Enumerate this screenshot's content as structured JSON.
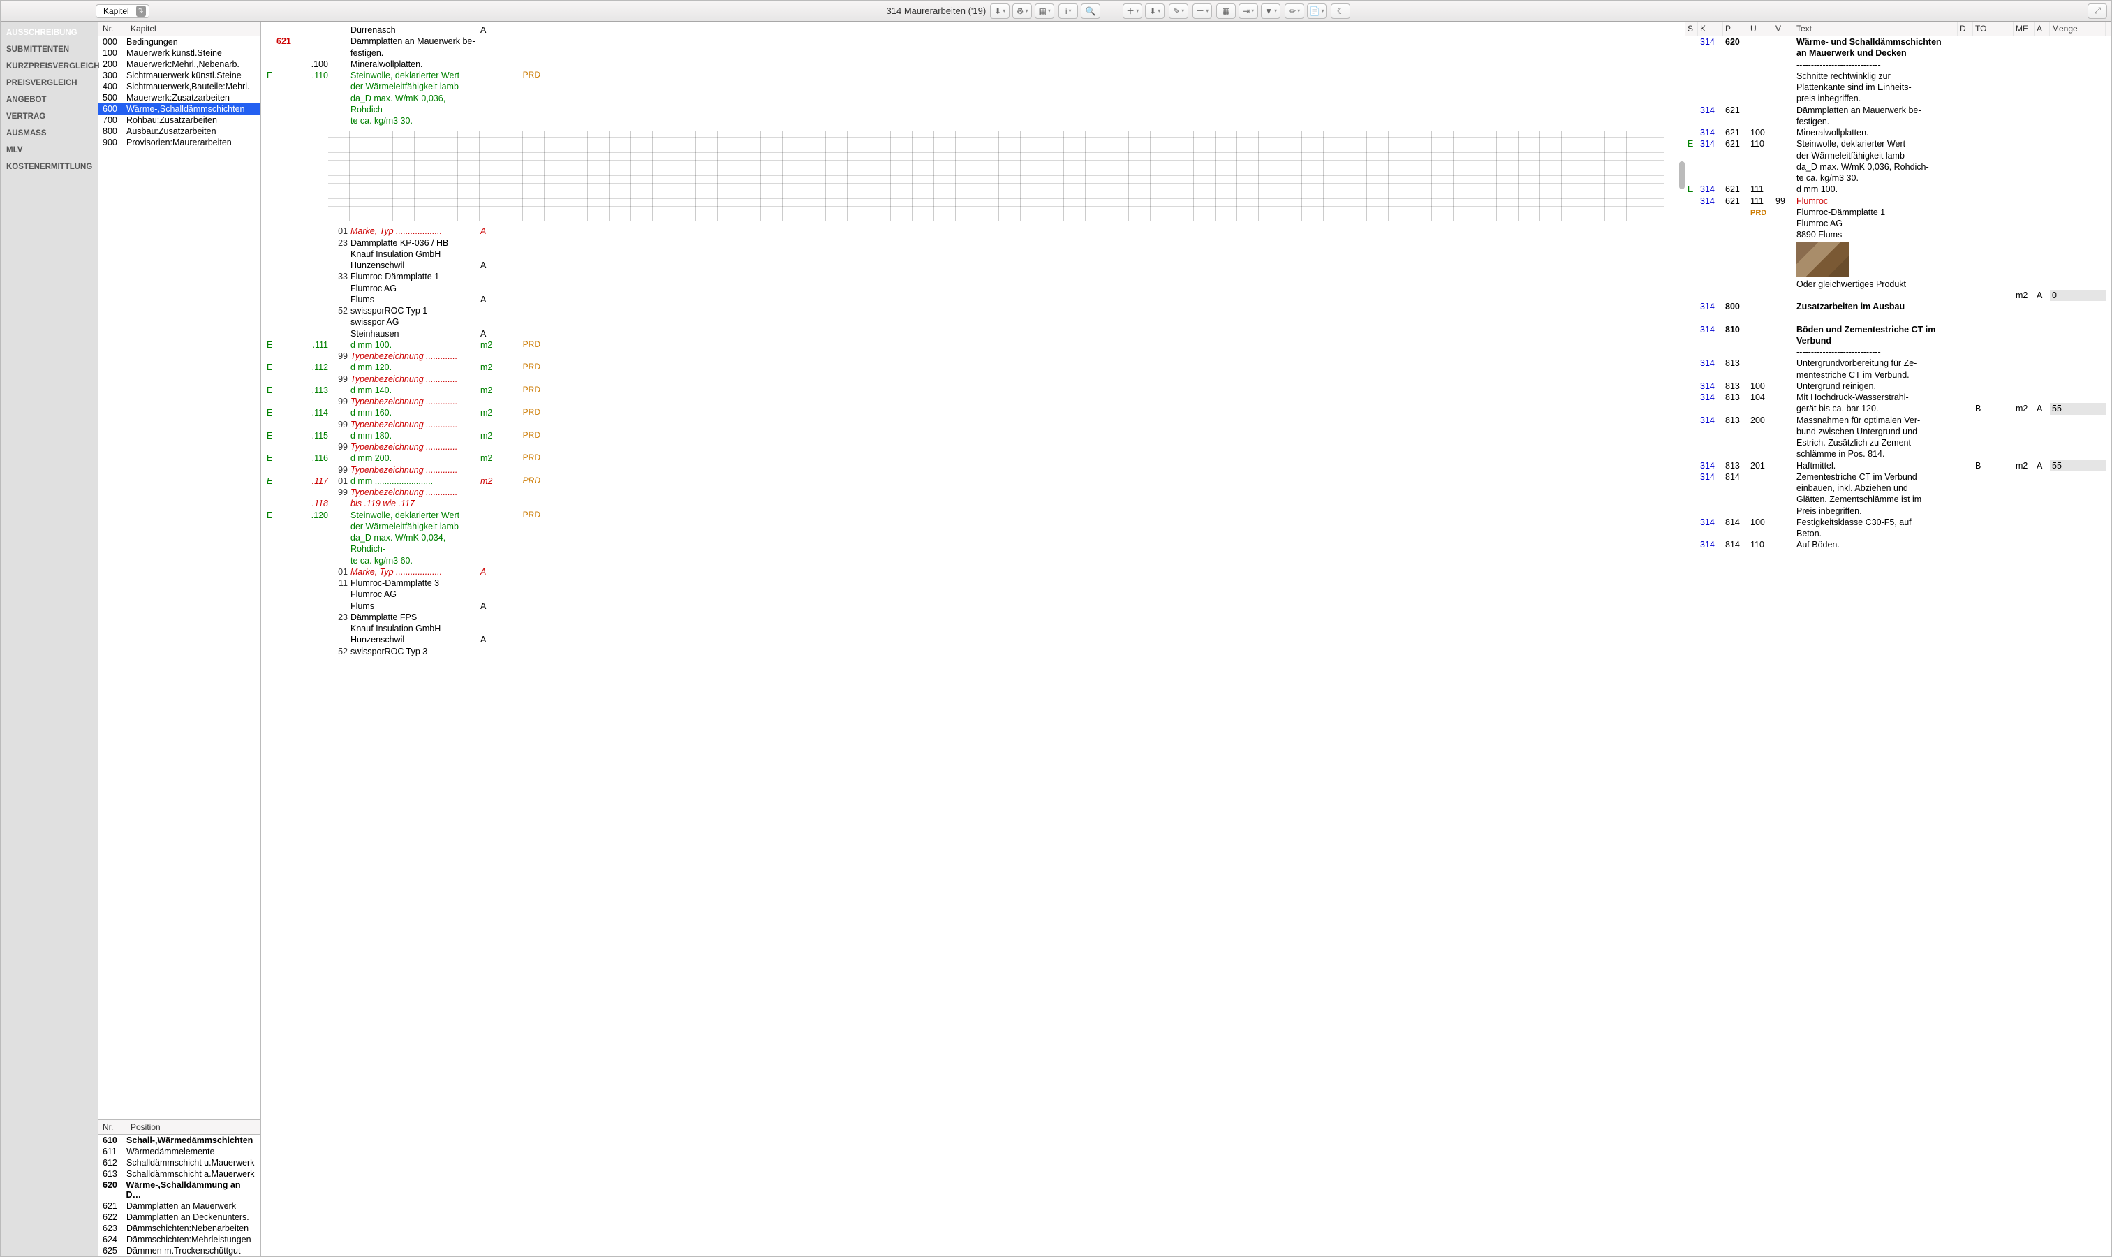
{
  "toolbar": {
    "dropdown_label": "Kapitel",
    "title": "314 Maurerarbeiten ('19)"
  },
  "sidebar": {
    "items": [
      {
        "label": "AUSSCHREIBUNG",
        "active": true
      },
      {
        "label": "SUBMITTENTEN"
      },
      {
        "label": "KURZPREISVERGLEICH"
      },
      {
        "label": "PREISVERGLEICH"
      },
      {
        "label": "ANGEBOT"
      },
      {
        "label": "VERTRAG"
      },
      {
        "label": "AUSMASS"
      },
      {
        "label": "MLV"
      },
      {
        "label": "KOSTENERMITTLUNG"
      }
    ]
  },
  "kapitel": {
    "headers": {
      "nr": "Nr.",
      "kapitel": "Kapitel"
    },
    "rows": [
      {
        "nr": "000",
        "label": "Bedingungen"
      },
      {
        "nr": "100",
        "label": "Mauerwerk künstl.Steine"
      },
      {
        "nr": "200",
        "label": "Mauerwerk:Mehrl.,Nebenarb."
      },
      {
        "nr": "300",
        "label": "Sichtmauerwerk künstl.Steine"
      },
      {
        "nr": "400",
        "label": "Sichtmauerwerk,Bauteile:Mehrl."
      },
      {
        "nr": "500",
        "label": "Mauerwerk:Zusatzarbeiten"
      },
      {
        "nr": "600",
        "label": "Wärme-,Schalldämmschichten",
        "selected": true
      },
      {
        "nr": "700",
        "label": "Rohbau:Zusatzarbeiten"
      },
      {
        "nr": "800",
        "label": "Ausbau:Zusatzarbeiten"
      },
      {
        "nr": "900",
        "label": "Provisorien:Maurerarbeiten"
      }
    ]
  },
  "position": {
    "headers": {
      "nr": "Nr.",
      "pos": "Position"
    },
    "rows": [
      {
        "nr": "610",
        "label": "Schall-,Wärmedämmschichten",
        "bold": true
      },
      {
        "nr": "611",
        "label": "Wärmedämmelemente"
      },
      {
        "nr": "612",
        "label": "Schalldämmschicht u.Mauerwerk"
      },
      {
        "nr": "613",
        "label": "Schalldämmschicht a.Mauerwerk"
      },
      {
        "nr": "620",
        "label": "Wärme-,Schalldämmung an D…",
        "bold": true
      },
      {
        "nr": "621",
        "label": "Dämmplatten an Mauerwerk"
      },
      {
        "nr": "622",
        "label": "Dämmplatten an Deckenunters."
      },
      {
        "nr": "623",
        "label": "Dämmschichten:Nebenarbeiten"
      },
      {
        "nr": "624",
        "label": "Dämmschichten:Mehrleistungen"
      },
      {
        "nr": "625",
        "label": "Dämmen m.Trockenschüttgut"
      }
    ]
  },
  "center": [
    {
      "text": "Dürrenäsch",
      "a": "A"
    },
    {
      "k": "621",
      "text": "Dämmplatten an Mauerwerk be-"
    },
    {
      "text": "festigen."
    },
    {
      "p": ".100",
      "text": "Mineralwollplatten."
    },
    {
      "e": "E",
      "p": ".110",
      "text": "Steinwolle, deklarierter Wert",
      "green": true,
      "tag": "PRD"
    },
    {
      "text": "der Wärmeleitfähigkeit lamb-",
      "green": true
    },
    {
      "text": "da_D max. W/mK 0,036, Rohdich-",
      "green": true
    },
    {
      "text": "te ca. kg/m3 30.",
      "green": true
    },
    {
      "sketch": true
    },
    {
      "u": "01",
      "text": "Marke, Typ ...................",
      "a": "A",
      "italred": true
    },
    {
      "u": "23",
      "text": "Dämmplatte KP-036 / HB"
    },
    {
      "text": "Knauf Insulation GmbH"
    },
    {
      "text": "Hunzenschwil",
      "a": "A"
    },
    {
      "u": "33",
      "text": "Flumroc-Dämmplatte 1"
    },
    {
      "text": "Flumroc AG"
    },
    {
      "text": "Flums",
      "a": "A"
    },
    {
      "u": "52",
      "text": "swissporROC Typ 1"
    },
    {
      "text": "swisspor AG"
    },
    {
      "text": "Steinhausen",
      "a": "A"
    },
    {
      "e": "E",
      "p": ".111",
      "text": "d mm 100.",
      "green": true,
      "me": "m2",
      "tag": "PRD"
    },
    {
      "u": "99",
      "text": "Typenbezeichnung .............",
      "italred": true
    },
    {
      "e": "E",
      "p": ".112",
      "text": "d mm 120.",
      "green": true,
      "me": "m2",
      "tag": "PRD"
    },
    {
      "u": "99",
      "text": "Typenbezeichnung .............",
      "italred": true
    },
    {
      "e": "E",
      "p": ".113",
      "text": "d mm 140.",
      "green": true,
      "me": "m2",
      "tag": "PRD"
    },
    {
      "u": "99",
      "text": "Typenbezeichnung .............",
      "italred": true
    },
    {
      "e": "E",
      "p": ".114",
      "text": "d mm 160.",
      "green": true,
      "me": "m2",
      "tag": "PRD"
    },
    {
      "u": "99",
      "text": "Typenbezeichnung .............",
      "italred": true
    },
    {
      "e": "E",
      "p": ".115",
      "text": "d mm 180.",
      "green": true,
      "me": "m2",
      "tag": "PRD"
    },
    {
      "u": "99",
      "text": "Typenbezeichnung .............",
      "italred": true
    },
    {
      "e": "E",
      "p": ".116",
      "text": "d mm 200.",
      "green": true,
      "me": "m2",
      "tag": "PRD"
    },
    {
      "u": "99",
      "text": "Typenbezeichnung .............",
      "italred": true
    },
    {
      "e": "E",
      "p": ".117",
      "u": "01",
      "text": "d mm ........................",
      "green": true,
      "italred": true,
      "me": "m2",
      "tag": "PRD"
    },
    {
      "u": "99",
      "text": "Typenbezeichnung .............",
      "italred": true
    },
    {
      "p": ".118",
      "text": "bis .119 wie .117",
      "italred": true
    },
    {
      "e": "E",
      "p": ".120",
      "text": "Steinwolle, deklarierter Wert",
      "green": true,
      "tag": "PRD"
    },
    {
      "text": "der Wärmeleitfähigkeit lamb-",
      "green": true
    },
    {
      "text": "da_D max. W/mK 0,034, Rohdich-",
      "green": true
    },
    {
      "text": "te ca. kg/m3 60.",
      "green": true
    },
    {
      "u": "01",
      "text": "Marke, Typ ...................",
      "a": "A",
      "italred": true
    },
    {
      "u": "11",
      "text": "Flumroc-Dämmplatte 3"
    },
    {
      "text": "Flumroc AG"
    },
    {
      "text": "Flums",
      "a": "A"
    },
    {
      "u": "23",
      "text": "Dämmplatte FPS"
    },
    {
      "text": "Knauf Insulation GmbH"
    },
    {
      "text": "Hunzenschwil",
      "a": "A"
    },
    {
      "u": "52",
      "text": "swissporROC Typ 3"
    }
  ],
  "right": {
    "headers": {
      "s": "S",
      "k": "K",
      "p": "P",
      "u": "U",
      "v": "V",
      "text": "Text",
      "d": "D",
      "to": "TO",
      "me": "ME",
      "a": "A",
      "menge": "Menge"
    },
    "rows": [
      {
        "k": "314",
        "p": "620",
        "text": "Wärme- und Schalldämmschichten",
        "bold": true
      },
      {
        "text": "an Mauerwerk und Decken",
        "bold": true
      },
      {
        "text": "-----------------------------"
      },
      {
        "text": "Schnitte rechtwinklig zur"
      },
      {
        "text": "Plattenkante sind im Einheits-"
      },
      {
        "text": "preis inbegriffen."
      },
      {
        "k": "314",
        "p": "621",
        "text": "Dämmplatten an Mauerwerk be-"
      },
      {
        "text": "festigen."
      },
      {
        "k": "314",
        "p": "621",
        "u": "100",
        "text": "Mineralwollplatten."
      },
      {
        "s": "E",
        "k": "314",
        "p": "621",
        "u": "110",
        "text": "Steinwolle, deklarierter Wert"
      },
      {
        "text": "der Wärmeleitfähigkeit lamb-"
      },
      {
        "text": "da_D max. W/mK 0,036, Rohdich-"
      },
      {
        "text": "te ca. kg/m3 30."
      },
      {
        "s": "E",
        "k": "314",
        "p": "621",
        "u": "111",
        "text": "d mm 100."
      },
      {
        "k": "314",
        "p": "621",
        "u": "111",
        "v": "99",
        "text": "Flumroc",
        "red": true
      },
      {
        "u_label": "PRD",
        "prd": true,
        "text": "Flumroc-Dämmplatte 1"
      },
      {
        "text": "Flumroc AG"
      },
      {
        "text": "8890 Flums"
      },
      {
        "img": true
      },
      {
        "text": "Oder gleichwertiges Produkt"
      },
      {
        "me": "m2",
        "a": "A",
        "menge": "0"
      },
      {
        "blank": true
      },
      {
        "k": "314",
        "p": "800",
        "text": "Zusatzarbeiten im Ausbau",
        "bold": true
      },
      {
        "text": "-----------------------------"
      },
      {
        "blank": true
      },
      {
        "k": "314",
        "p": "810",
        "text": "Böden und Zementestriche CT im",
        "bold": true
      },
      {
        "text": "Verbund",
        "bold": true
      },
      {
        "text": "-----------------------------"
      },
      {
        "k": "314",
        "p": "813",
        "text": "Untergrundvorbereitung für Ze-"
      },
      {
        "text": "mentestriche CT im Verbund."
      },
      {
        "k": "314",
        "p": "813",
        "u": "100",
        "text": "Untergrund reinigen."
      },
      {
        "k": "314",
        "p": "813",
        "u": "104",
        "text": "Mit Hochdruck-Wasserstrahl-"
      },
      {
        "text": "gerät bis ca. bar 120.",
        "to": "B",
        "me": "m2",
        "a": "A",
        "menge": "55"
      },
      {
        "k": "314",
        "p": "813",
        "u": "200",
        "text": "Massnahmen für optimalen Ver-"
      },
      {
        "text": "bund zwischen Untergrund und"
      },
      {
        "text": "Estrich. Zusätzlich zu Zement-"
      },
      {
        "text": "schlämme in Pos. 814."
      },
      {
        "k": "314",
        "p": "813",
        "u": "201",
        "text": "Haftmittel.",
        "to": "B",
        "me": "m2",
        "a": "A",
        "menge": "55"
      },
      {
        "blank": true
      },
      {
        "k": "314",
        "p": "814",
        "text": "Zementestriche CT im Verbund"
      },
      {
        "text": "einbauen, inkl. Abziehen und"
      },
      {
        "text": "Glätten. Zementschlämme ist im"
      },
      {
        "text": "Preis inbegriffen."
      },
      {
        "k": "314",
        "p": "814",
        "u": "100",
        "text": "Festigkeitsklasse C30-F5, auf"
      },
      {
        "text": "Beton."
      },
      {
        "k": "314",
        "p": "814",
        "u": "110",
        "text": "Auf Böden."
      }
    ]
  }
}
